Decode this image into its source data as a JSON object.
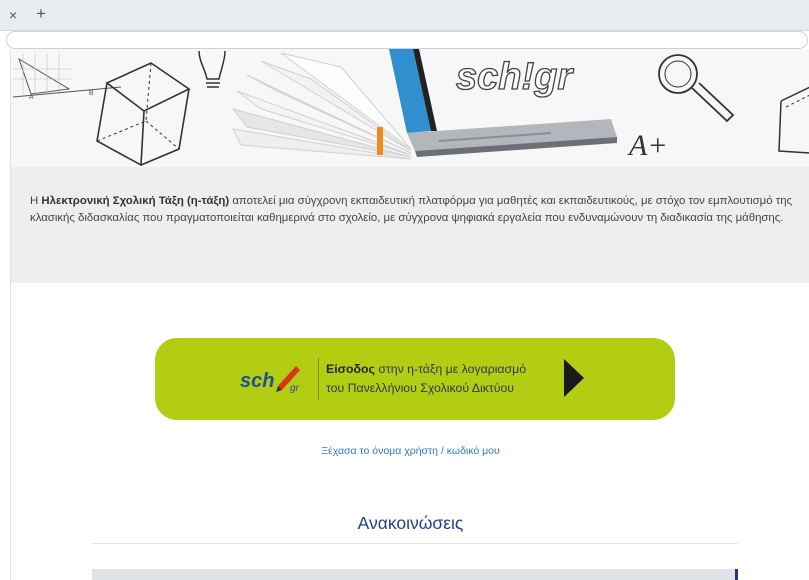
{
  "browser": {
    "tab_close": "×",
    "new_tab": "+"
  },
  "banner": {
    "logo_text": "sch!gr",
    "grade_text": "A+"
  },
  "intro": {
    "prefix": "Η ",
    "bold": "Ηλεκτρονική Σχολική Τάξη (η-τάξη)",
    "rest": " αποτελεί μια σύγχρονη εκπαιδευτική πλατφόρμα για μαθητές και εκπαιδευτικούς, με στόχο τον εμπλουτισμό της κλασικής διδασκαλίας που πραγματοποιείται καθημερινά στο σχολείο, με σύγχρονα ψηφιακά εργαλεία που ενδυναμώνουν τη διαδικασία της μάθησης."
  },
  "login": {
    "logo_sch": "sch",
    "logo_gr": "gr",
    "bold": "Είσοδος",
    "line1_rest": " στην η-τάξη με λογαριασμό",
    "line2": "του Πανελλήνιου Σχολικού Δικτύου"
  },
  "forgot_link": "Ξέχασα το όνομα χρήστη / κωδικό μου",
  "announcements": {
    "title": "Ανακοινώσεις"
  },
  "colors": {
    "login_button": "#b2cd12",
    "link": "#2e79c5",
    "heading": "#253f8f"
  }
}
